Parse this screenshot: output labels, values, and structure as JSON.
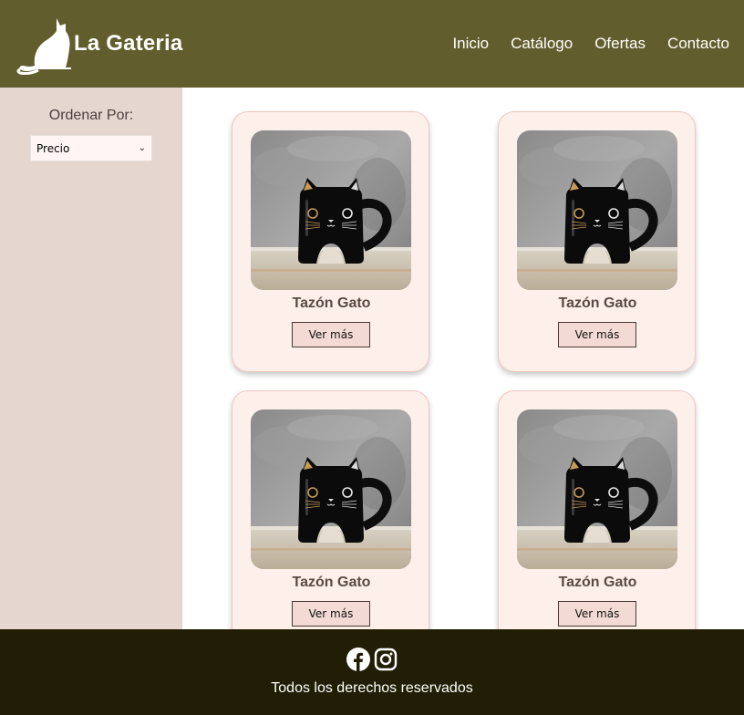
{
  "header": {
    "brand": "La Gateria",
    "logo_icon": "cat-silhouette-icon",
    "nav": [
      {
        "label": "Inicio"
      },
      {
        "label": "Catálogo"
      },
      {
        "label": "Ofertas"
      },
      {
        "label": "Contacto"
      }
    ],
    "background_color": "#625d2c"
  },
  "sidebar": {
    "sort_label": "Ordenar Por:",
    "sort_selected": "Precio",
    "background_color": "#e6d6d0"
  },
  "products": [
    {
      "title": "Tazón Gato",
      "button": "Ver más",
      "image": "black-cat-mug"
    },
    {
      "title": "Tazón Gato",
      "button": "Ver más",
      "image": "black-cat-mug"
    },
    {
      "title": "Tazón Gato",
      "button": "Ver más",
      "image": "black-cat-mug"
    },
    {
      "title": "Tazón Gato",
      "button": "Ver más",
      "image": "black-cat-mug"
    }
  ],
  "footer": {
    "social_icons": [
      "facebook-icon",
      "instagram-icon"
    ],
    "text": "Todos los derechos reservados",
    "background_color": "#221e05"
  }
}
